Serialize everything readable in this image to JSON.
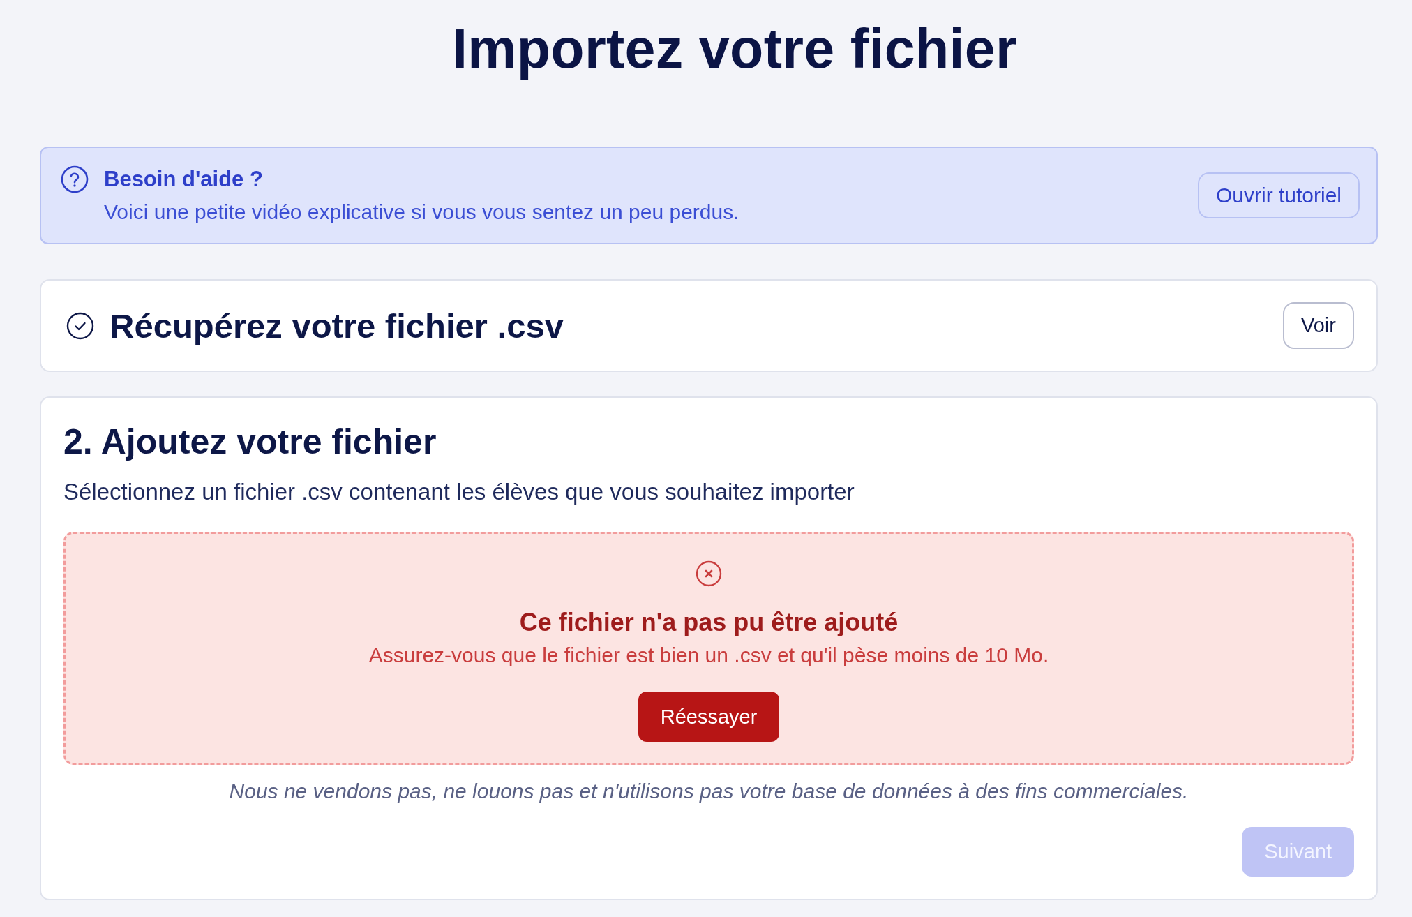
{
  "page_title": "Importez votre fichier",
  "help_banner": {
    "title": "Besoin d'aide ?",
    "text": "Voici une petite vidéo explicative si vous vous sentez un peu perdus.",
    "button": "Ouvrir tutoriel"
  },
  "step_1": {
    "title": "Récupérez votre fichier .csv",
    "completed": true,
    "button": "Voir"
  },
  "step_2": {
    "title": "2. Ajoutez votre fichier",
    "description": "Sélectionnez un fichier .csv contenant les élèves que vous souhaitez importer",
    "upload_zone": {
      "error": true,
      "title": "Ce fichier n'a pas pu être ajouté",
      "message": "Assurez-vous que le fichier est bien un .csv et qu'il pèse moins de 10 Mo.",
      "button": "Réessayer"
    },
    "disclaimer": "Nous ne vendons pas, ne louons pas et n'utilisons pas votre base de données à des fins commerciales.",
    "next_button": {
      "label": "Suivant",
      "disabled": true
    }
  }
}
